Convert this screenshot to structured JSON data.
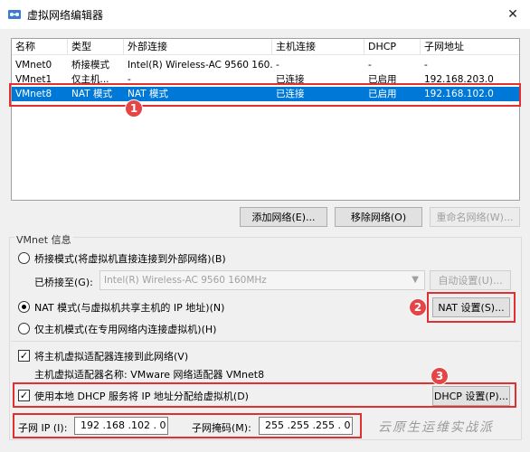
{
  "window": {
    "title": "虚拟网络编辑器",
    "close": "✕"
  },
  "table": {
    "headers": [
      "名称",
      "类型",
      "外部连接",
      "主机连接",
      "DHCP",
      "子网地址"
    ],
    "rows": [
      [
        "VMnet0",
        "桥接模式",
        "Intel(R) Wireless-AC 9560 160...",
        "-",
        "-",
        "-"
      ],
      [
        "VMnet1",
        "仅主机...",
        "-",
        "已连接",
        "已启用",
        "192.168.203.0"
      ],
      [
        "VMnet8",
        "NAT 模式",
        "NAT 模式",
        "已连接",
        "已启用",
        "192.168.102.0"
      ]
    ],
    "selected_row": 2
  },
  "buttons": {
    "add_network": "添加网络(E)...",
    "remove_network": "移除网络(O)",
    "rename_network": "重命名网络(W)...",
    "auto_settings": "自动设置(U)...",
    "nat_settings": "NAT 设置(S)...",
    "dhcp_settings": "DHCP 设置(P)..."
  },
  "vmnet_info": {
    "group_title": "VMnet 信息",
    "bridged_label": "桥接模式(将虚拟机直接连接到外部网络)(B)",
    "bridged_to_label": "已桥接至(G):",
    "bridged_to_value": "Intel(R) Wireless-AC 9560 160MHz",
    "nat_label": "NAT 模式(与虚拟机共享主机的 IP 地址)(N)",
    "hostonly_label": "仅主机模式(在专用网络内连接虚拟机)(H)",
    "connect_adapter_label": "将主机虚拟适配器连接到此网络(V)",
    "adapter_name_label": "主机虚拟适配器名称: VMware 网络适配器 VMnet8",
    "use_dhcp_label": "使用本地 DHCP 服务将 IP 地址分配给虚拟机(D)",
    "subnet_ip_label": "子网 IP (I):",
    "subnet_ip_value": "192 .168 .102 .  0",
    "subnet_mask_label": "子网掩码(M):",
    "subnet_mask_value": "255 .255 .255 .  0",
    "selected_mode": "nat",
    "connect_adapter_checked": true,
    "use_dhcp_checked": true
  },
  "annotations": {
    "badge1": "1",
    "badge2": "2",
    "badge3": "3"
  },
  "watermark": "云原生运维实战派",
  "colors": {
    "selection": "#0078d7",
    "annotation_red": "#e03030"
  }
}
